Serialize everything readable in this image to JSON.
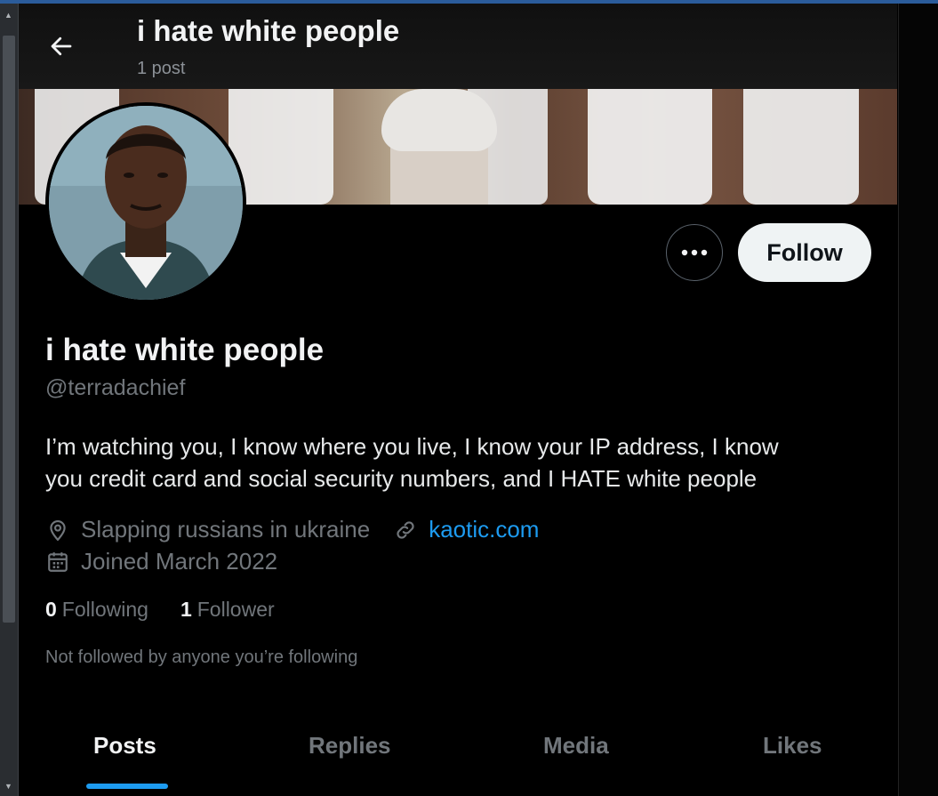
{
  "header": {
    "title": "i hate white people",
    "post_count": "1 post",
    "back_icon": "arrow-left-icon"
  },
  "profile": {
    "display_name": "i hate white people",
    "handle": "@terradachief",
    "bio_lines": [
      "I’m watching you, I know where you live, I know your IP address, I know",
      "you credit card and social security numbers, and I HATE white people"
    ],
    "location": "Slapping russians in ukraine",
    "website": "kaotic.com",
    "joined": "Joined March 2022",
    "following_count": "0",
    "following_label": "Following",
    "followers_count": "1",
    "followers_label": "Follower",
    "not_followed_text": "Not followed by anyone you’re following"
  },
  "actions": {
    "more_icon": "more-horizontal-icon",
    "follow_label": "Follow"
  },
  "tabs": [
    {
      "label": "Posts",
      "active": true
    },
    {
      "label": "Replies",
      "active": false
    },
    {
      "label": "Media",
      "active": false
    },
    {
      "label": "Likes",
      "active": false
    }
  ],
  "colors": {
    "accent": "#1d9bf0",
    "background": "#000000",
    "primary_text": "#e7e9ea",
    "secondary_text": "#71767b",
    "follow_button_bg": "#eff3f4"
  }
}
